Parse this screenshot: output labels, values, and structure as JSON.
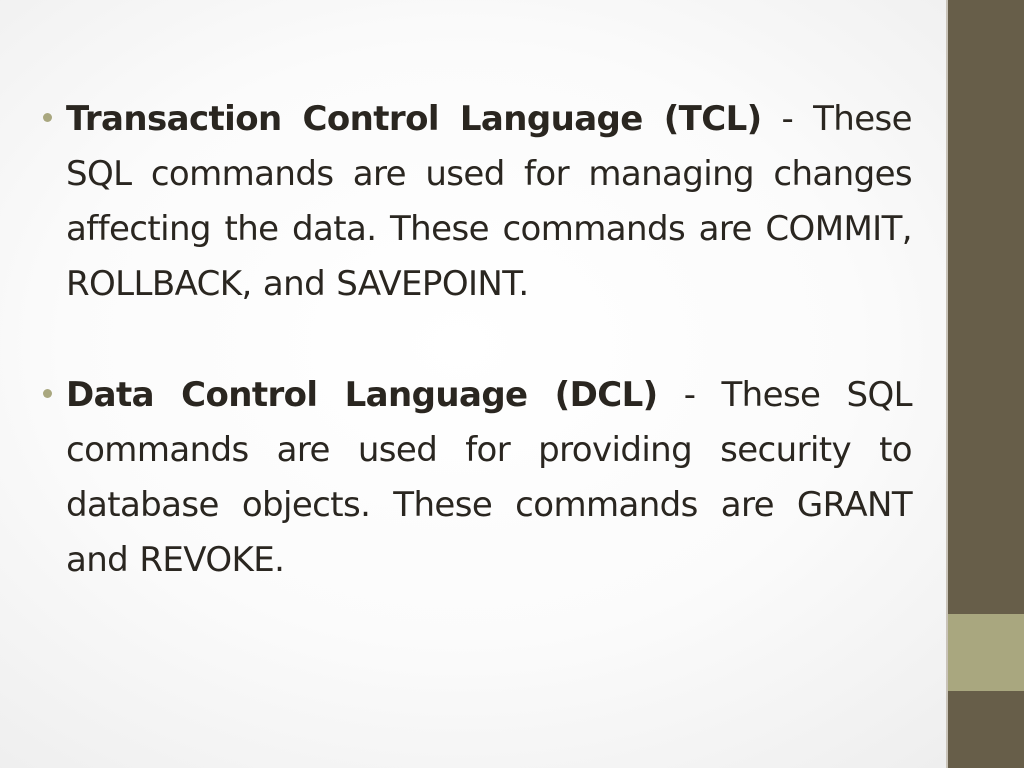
{
  "slide": {
    "colors": {
      "dark_bar": "#675e49",
      "light_bar": "#a9a77f",
      "text": "#2a2620",
      "bullet": "#a9a77f"
    },
    "bullets": [
      {
        "term": "Transaction Control Language (TCL)",
        "description": " - These SQL commands are used for managing changes affecting the data. These commands are COMMIT, ROLLBACK, and SAVEPOINT."
      },
      {
        "term": "Data Control Language (DCL)",
        "description": " - These SQL commands are used for providing security to database objects. These commands are GRANT and REVOKE."
      }
    ]
  }
}
